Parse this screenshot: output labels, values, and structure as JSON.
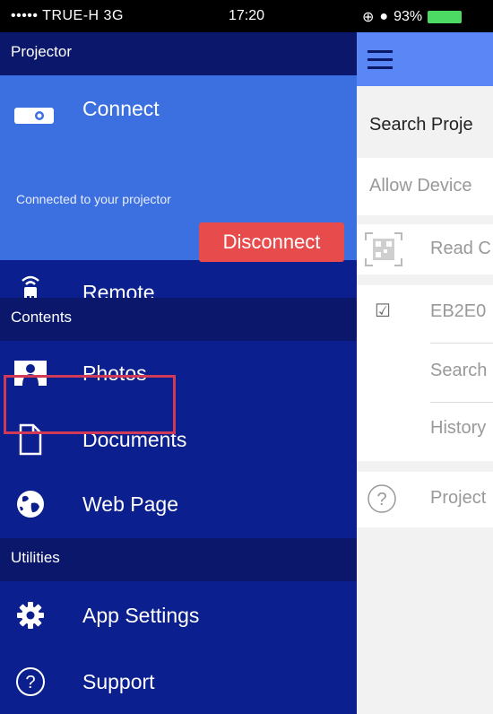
{
  "status_bar": {
    "carrier": "••••• TRUE-H  3G",
    "time": "17:20",
    "battery": "93%"
  },
  "drawer": {
    "projector_header": "Projector",
    "connect": {
      "label": "Connect",
      "status": "Connected to your projector",
      "disconnect_label": "Disconnect"
    },
    "remote_label": "Remote",
    "contents_header": "Contents",
    "photos_label": "Photos",
    "documents_label": "Documents",
    "web_page_label": "Web Page",
    "utilities_header": "Utilities",
    "app_settings_label": "App Settings",
    "support_label": "Support"
  },
  "right_panel": {
    "search_title": "Search Proje",
    "allow_devices": "Allow Device",
    "read_qr": "Read C",
    "device_item": "EB2E0",
    "search": "Search",
    "history": "History",
    "projector_help": "Project"
  },
  "colors": {
    "drawer_bg": "#0c1f8e",
    "section_bg": "#0a176b",
    "connect_bg": "#3c6fe0",
    "disconnect_bg": "#e84b4b",
    "highlight_border": "#d03a57",
    "topbar_bg": "#5b86f5"
  }
}
